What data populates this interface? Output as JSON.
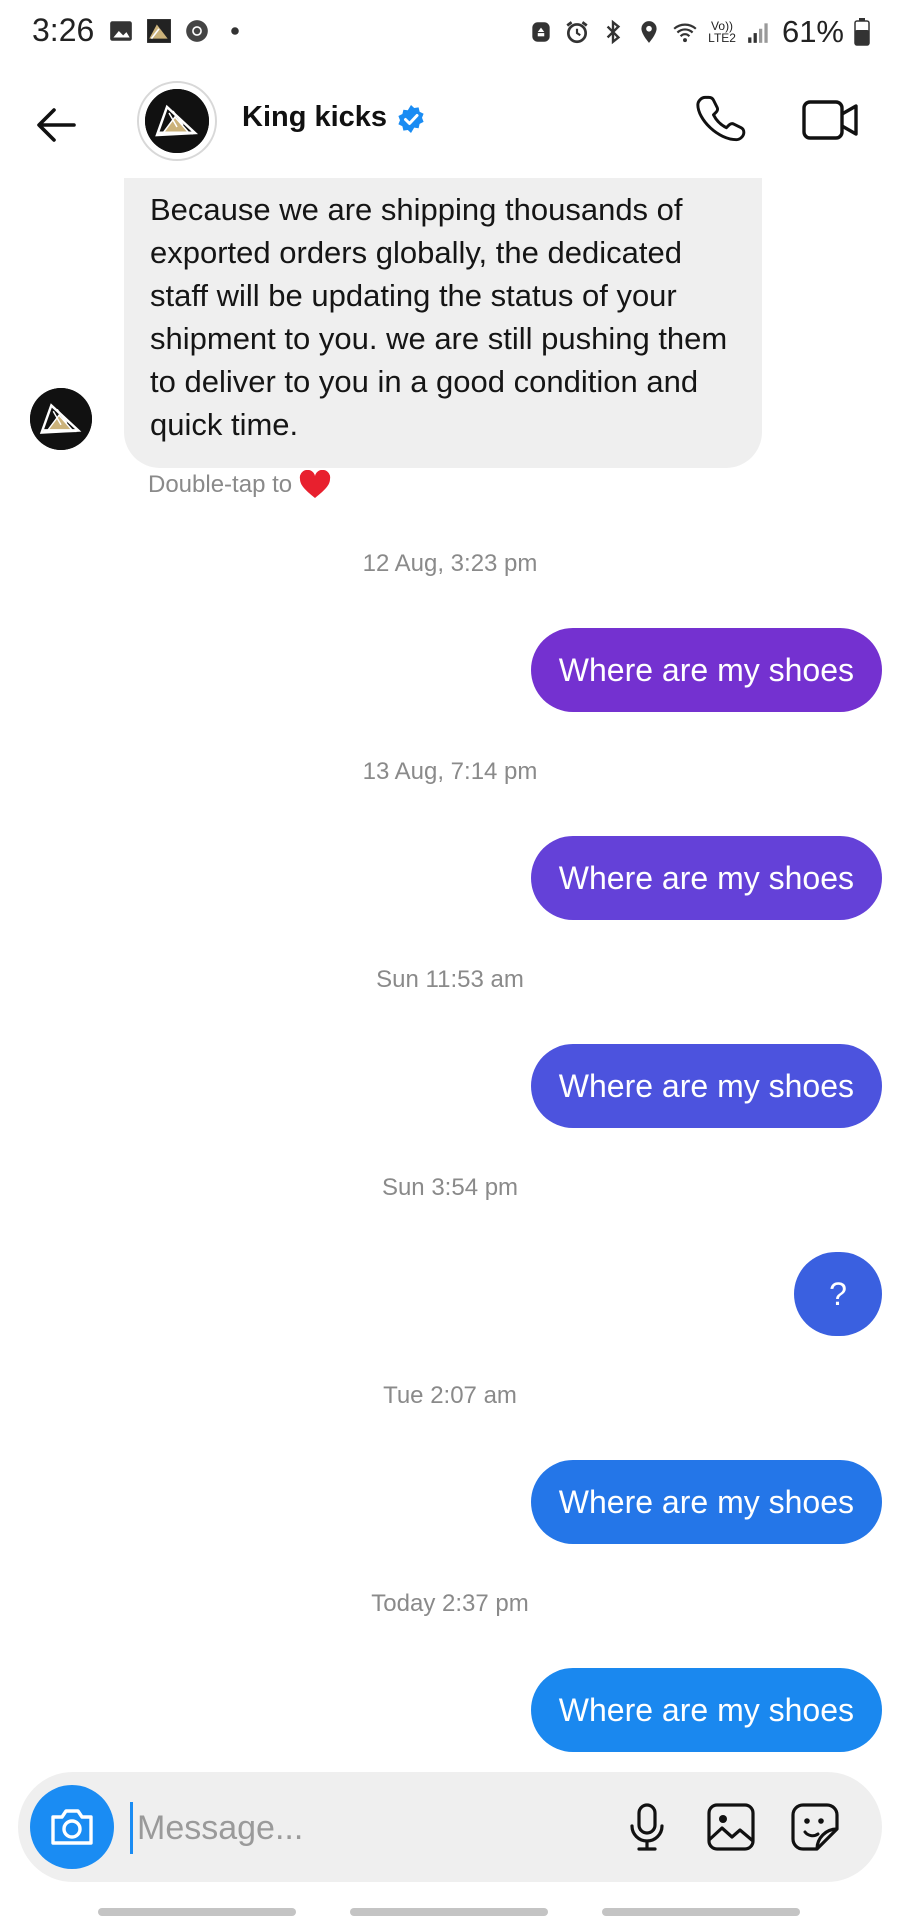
{
  "status_bar": {
    "time": "3:26",
    "battery": "61%",
    "network_top": "Vo))",
    "network_bottom": "LTE2",
    "icons": [
      "gallery-icon",
      "app-thumb-icon",
      "chrome-icon",
      "dot-icon",
      "recycle-icon",
      "alarm-icon",
      "bluetooth-icon",
      "location-icon",
      "wifi-icon",
      "signal-icon",
      "battery-icon"
    ]
  },
  "header": {
    "contact_name": "King kicks",
    "verified": true,
    "accent": "#1a8cf3"
  },
  "messages": {
    "received_text": "Because we are shipping thousands of exported orders globally, the dedicated staff will be updating the status of your shipment to you. we are still pushing them to deliver to you in a good condition and quick time.",
    "double_tap_hint": "Double-tap to",
    "sent": [
      {
        "timestamp": "12 Aug, 3:23 pm",
        "text": "Where are my shoes",
        "color": "#7431d0"
      },
      {
        "timestamp": "13 Aug, 7:14 pm",
        "text": "Where are my shoes",
        "color": "#6441d8"
      },
      {
        "timestamp": "Sun 11:53 am",
        "text": "Where are my shoes",
        "color": "#4c53de"
      },
      {
        "timestamp": "Sun 3:54 pm",
        "text": "?",
        "color": "#3a60e0"
      },
      {
        "timestamp": "Tue 2:07 am",
        "text": "Where are my shoes",
        "color": "#2476e8"
      },
      {
        "timestamp": "Today 2:37 pm",
        "text": "Where are my shoes",
        "color": "#1a88ef"
      }
    ]
  },
  "composer": {
    "placeholder": "Message..."
  }
}
